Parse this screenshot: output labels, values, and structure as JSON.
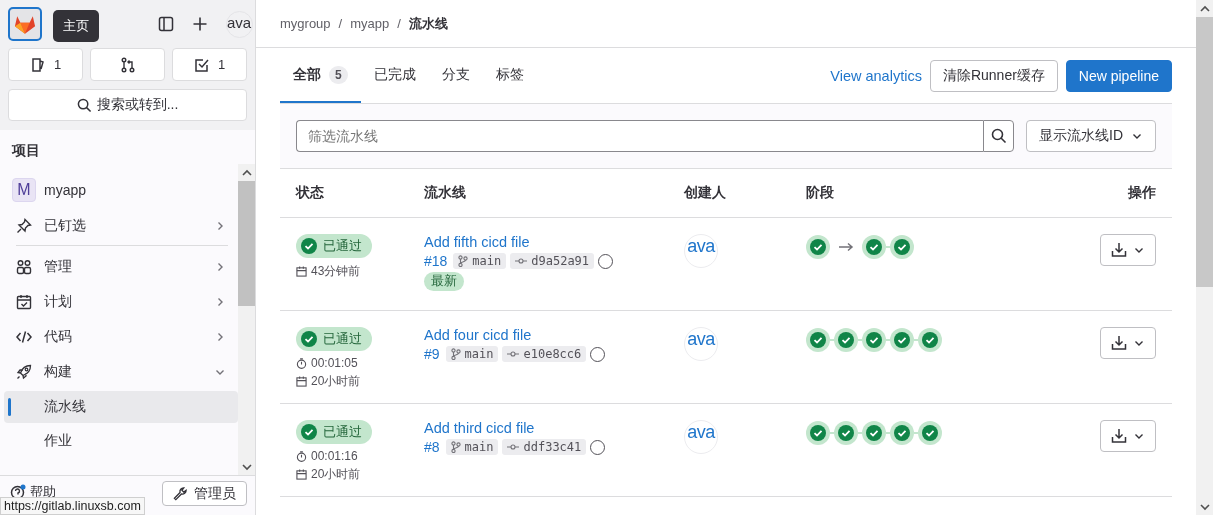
{
  "sidebar": {
    "home_tooltip": "主页",
    "avatar": "ava",
    "counters": [
      {
        "kind": "issues",
        "count": "1"
      },
      {
        "kind": "merge_requests"
      },
      {
        "kind": "todos",
        "count": "1"
      }
    ],
    "search": "搜索或转到...",
    "section_title": "项目",
    "project": {
      "initial": "M",
      "name": "myapp"
    },
    "items": [
      {
        "label": "已钉选",
        "expanded": false
      },
      {
        "label": "管理",
        "expanded": false
      },
      {
        "label": "计划",
        "expanded": false
      },
      {
        "label": "代码",
        "expanded": false
      },
      {
        "label": "构建",
        "expanded": true,
        "children": [
          {
            "label": "流水线",
            "selected": true
          },
          {
            "label": "作业",
            "selected": false
          }
        ]
      }
    ],
    "help": "帮助",
    "admin": "管理员"
  },
  "status_url": "https://gitlab.linuxsb.com",
  "breadcrumb": [
    {
      "label": "mygroup"
    },
    {
      "separator": "/",
      "label": "myapp"
    },
    {
      "separator": "/",
      "label": "流水线"
    }
  ],
  "tabs": [
    {
      "label": "全部",
      "count": "5",
      "selected": true
    },
    {
      "label": "已完成",
      "selected": false
    },
    {
      "label": "分支",
      "selected": false
    },
    {
      "label": "标签",
      "selected": false
    }
  ],
  "actions": {
    "analytics": "View analytics",
    "clear_cache": "清除Runner缓存",
    "new_pipeline": "New pipeline"
  },
  "filter": {
    "placeholder": "筛选流水线",
    "display": "显示流水线ID"
  },
  "columns": [
    "状态",
    "流水线",
    "创建人",
    "阶段",
    "操作"
  ],
  "rows": [
    {
      "status": {
        "kind": "passed",
        "label": "已通过"
      },
      "time": "43分钟前",
      "title": "Add fifth cicd file",
      "id": "#18",
      "branch": "main",
      "sha": "d9a52a91",
      "tags": [
        "最新"
      ],
      "creator": "ava",
      "stages": [
        {
          "kind": "passed"
        },
        {
          "kind": "arrow"
        },
        {
          "kind": "passed"
        },
        {
          "kind": "passed"
        }
      ]
    },
    {
      "status": {
        "kind": "passed",
        "label": "已通过"
      },
      "duration": "00:01:05",
      "time": "20小时前",
      "title": "Add four cicd file",
      "id": "#9",
      "branch": "main",
      "sha": "e10e8cc6",
      "creator": "ava",
      "stages": [
        {
          "kind": "passed"
        },
        {
          "kind": "passed"
        },
        {
          "kind": "passed"
        },
        {
          "kind": "passed"
        },
        {
          "kind": "passed"
        }
      ]
    },
    {
      "status": {
        "kind": "passed",
        "label": "已通过"
      },
      "duration": "00:01:16",
      "time": "20小时前",
      "title": "Add third cicd file",
      "id": "#8",
      "branch": "main",
      "sha": "ddf33c41",
      "creator": "ava",
      "stages": [
        {
          "kind": "passed"
        },
        {
          "kind": "passed"
        },
        {
          "kind": "passed"
        },
        {
          "kind": "passed"
        },
        {
          "kind": "passed"
        }
      ]
    }
  ]
}
